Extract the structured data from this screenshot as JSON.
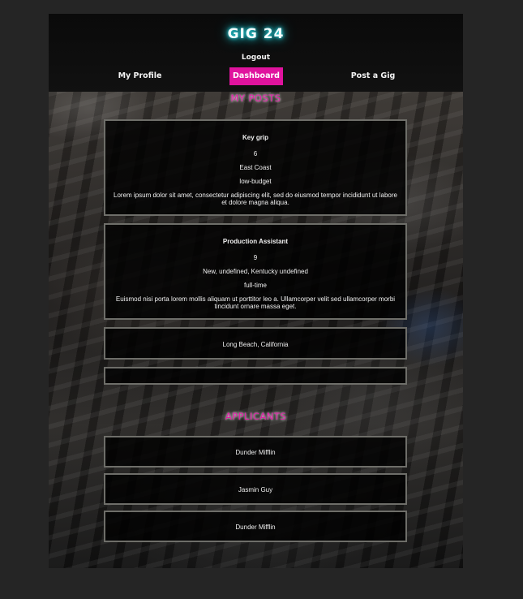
{
  "header": {
    "logo": "GIG 24",
    "logout_label": "Logout"
  },
  "nav": {
    "profile": "My Profile",
    "dashboard": "Dashboard",
    "post_gig": "Post a Gig",
    "active": "Dashboard"
  },
  "colors": {
    "accent": "#e0139e",
    "logo_glow": "#29d9e3",
    "card_border": "#6e6e69"
  },
  "my_posts": {
    "title": "MY POSTS",
    "posts": [
      {
        "role": "Key grip",
        "count": "6",
        "location": "East Coast",
        "budget": "low-budget",
        "description": "Lorem ipsum dolor sit amet, consectetur adipiscing elit, sed do eiusmod tempor incididunt ut labore et dolore magna aliqua."
      },
      {
        "role": "Production Assistant",
        "count": "9",
        "location": "New, undefined, Kentucky undefined",
        "budget": "full-time",
        "description": "Euismod nisi porta lorem mollis aliquam ut porttitor leo a. Ullamcorper velit sed ullamcorper morbi tincidunt ornare massa eget."
      },
      {
        "location": "Long Beach, California"
      },
      {}
    ]
  },
  "applicants": {
    "title": "APPLICANTS",
    "items": [
      "Dunder Mifflin",
      "Jasmin Guy",
      "Dunder Mifflin"
    ]
  }
}
